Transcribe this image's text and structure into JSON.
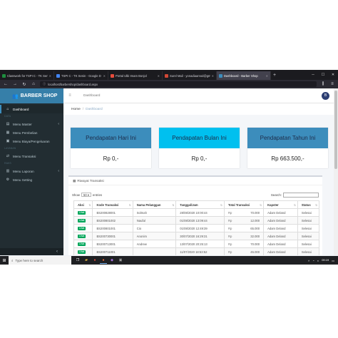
{
  "browser": {
    "tabs": [
      {
        "title": "Classwork for TSPI C - TK Senin",
        "favicon_color": "#1e8e3e",
        "active": false
      },
      {
        "title": "TSPI C - TK Senin - Google D",
        "favicon_color": "#4285f4",
        "active": false
      },
      {
        "title": "Portal Ulbi Imam Bonjol",
        "favicon_color": "#e74c3c",
        "active": false
      },
      {
        "title": "Surel Mail - yonadiaamod@gm",
        "favicon_color": "#d14836",
        "active": false
      },
      {
        "title": "Dashboard - Barber Shop",
        "favicon_color": "#3c8dbc",
        "active": true
      }
    ],
    "new_tab_label": "+",
    "url": "localhost/barbershop/dashboard.aspx"
  },
  "sidebar": {
    "brand": "BARBER SHOP",
    "items": [
      {
        "type": "item",
        "label": "Dashboard",
        "icon": "home-icon",
        "glyph": "⌂",
        "active": true
      },
      {
        "type": "head",
        "label": "DATA"
      },
      {
        "type": "item",
        "label": "Menu Master",
        "icon": "database-icon",
        "glyph": "▤",
        "chevron": true
      },
      {
        "type": "item",
        "label": "Menu Pembelian",
        "icon": "cart-icon",
        "glyph": "▦"
      },
      {
        "type": "item",
        "label": "Menu Biaya/Pengeluaran",
        "icon": "wallet-icon",
        "glyph": "▣"
      },
      {
        "type": "head",
        "label": "LAYANAN"
      },
      {
        "type": "item",
        "label": "Menu Transaksi",
        "icon": "exchange-icon",
        "glyph": "⇄"
      },
      {
        "type": "head",
        "label": "RAKS"
      },
      {
        "type": "item",
        "label": "Menu Laporan",
        "icon": "report-icon",
        "glyph": "▥",
        "chevron": true
      },
      {
        "type": "item",
        "label": "Menu Setting",
        "icon": "gear-icon",
        "glyph": "⚙"
      }
    ],
    "collapse_glyph": "‹"
  },
  "topbar": {
    "title": "Dashboard",
    "logo_text": "B"
  },
  "breadcrumb": {
    "home": "Home",
    "separator": "/",
    "current": "Dashboard"
  },
  "cards": [
    {
      "title": "Pendapatan Hari Ini",
      "value": "Rp 0,-",
      "color": "#3c8dbc"
    },
    {
      "title": "Pendapatan Bulan Ini",
      "value": "Rp 0,-",
      "color": "#00c0ef"
    },
    {
      "title": "Pendapatan Tahun Ini",
      "value": "Rp 663.500,-",
      "color": "#3c8dbc"
    }
  ],
  "history": {
    "title": "Riwayat Transaksi",
    "show_label": "Show",
    "entries_value": "50",
    "entries_label": "entries",
    "search_label": "Search:",
    "columns": [
      "Aksi",
      "Kode Transaksi",
      "Nama Pelanggan",
      "Tanggal/Jam",
      "Total Transaksi",
      "Kapster",
      "Status"
    ],
    "action_label": "Lihat",
    "rows": [
      {
        "kode": "BS200828001",
        "nama": "Solmah",
        "tanggal": "28/08/2020 10:00:44",
        "rp": "Rp",
        "total": "70.000",
        "kapster": "Adam Deland",
        "status": "Selesai"
      },
      {
        "kode": "BS200801002",
        "nama": "Naufal",
        "tanggal": "01/08/2020 13:09:44",
        "rp": "Rp",
        "total": "12.000",
        "kapster": "Adam Deland",
        "status": "Selesai"
      },
      {
        "kode": "BS200801001",
        "nama": "Cio",
        "tanggal": "01/08/2020 12:49:39",
        "rp": "Rp",
        "total": "65.000",
        "kapster": "Adam Deland",
        "status": "Selesai"
      },
      {
        "kode": "BS200730001",
        "nama": "Anonim",
        "tanggal": "30/07/2020 16:29:31",
        "rp": "Rp",
        "total": "32.000",
        "kapster": "Adam Deland",
        "status": "Selesai"
      },
      {
        "kode": "BS200713001",
        "nama": "Andrew",
        "tanggal": "13/07/2020 20:25:13",
        "rp": "Rp",
        "total": "70.000",
        "kapster": "Adam Deland",
        "status": "Selesai"
      },
      {
        "kode": "BS200711001",
        "nama": "",
        "tanggal": "11/07/2020 18:53:52",
        "rp": "Rp",
        "total": "45.000",
        "kapster": "Adam Deland",
        "status": "Selesai"
      }
    ]
  },
  "taskbar": {
    "search_placeholder": "Type here to search",
    "time": "09:19",
    "date": ""
  }
}
